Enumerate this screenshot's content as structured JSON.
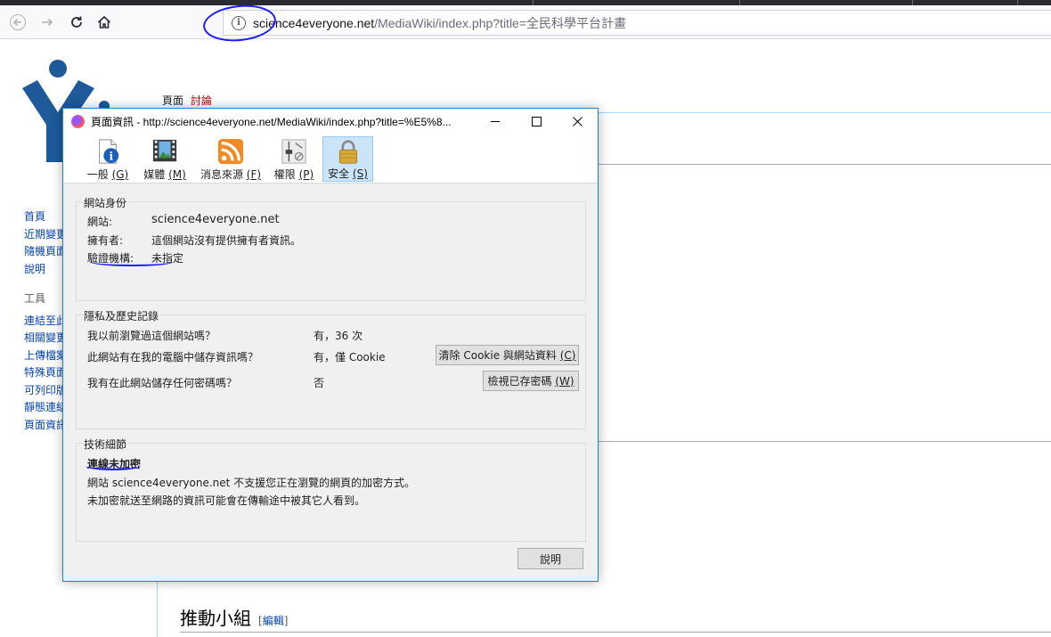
{
  "browser": {
    "url_host": "science4everyone.net",
    "url_path": "/MediaWiki/index.php?title=全民科學平台計畫"
  },
  "wiki": {
    "tab_page": "頁面",
    "tab_talk": "討論",
    "sidebar_main": [
      "首頁",
      "近期變更",
      "隨機頁面",
      "說明"
    ],
    "sidebar_tools_heading": "工具",
    "sidebar_tools": [
      "連結至此的頁面",
      "相關變更",
      "上傳檔案",
      "特殊頁面",
      "可列印版",
      "靜態連結",
      "頁面資訊"
    ],
    "section_title": "推動小組",
    "section_edit_open": "[",
    "section_edit": "編輯",
    "section_edit_close": "]"
  },
  "dialog": {
    "title": "頁面資訊 - http://science4everyone.net/MediaWiki/index.php?title=%E5%8...",
    "tabs": [
      {
        "label": "一般",
        "key": "(G)",
        "icon": "info-icon"
      },
      {
        "label": "媒體",
        "key": "(M)",
        "icon": "media-icon"
      },
      {
        "label": "消息來源",
        "key": "(F)",
        "icon": "rss-icon"
      },
      {
        "label": "權限",
        "key": "(P)",
        "icon": "permissions-icon"
      },
      {
        "label": "安全",
        "key": "(S)",
        "icon": "lock-icon"
      }
    ],
    "identity": {
      "legend": "網站身份",
      "website_label": "網站:",
      "website_value": "science4everyone.net",
      "owner_label": "擁有者:",
      "owner_value": "這個網站沒有提供擁有者資訊。",
      "verifier_label": "驗證機構:",
      "verifier_value": "未指定"
    },
    "privacy": {
      "legend": "隱私及歷史記錄",
      "q1": "我以前瀏覽過這個網站嗎？",
      "a1": "有，36 次",
      "q2": "此網站有在我的電腦中儲存資訊嗎？",
      "a2": "有，僅 Cookie",
      "btn_clear": "清除 Cookie 與網站資料",
      "btn_clear_key": "(C)",
      "q3": "我有在此網站儲存任何密碼嗎？",
      "a3": "否",
      "btn_passwords": "檢視已存密碼",
      "btn_passwords_key": "(W)"
    },
    "technical": {
      "legend": "技術細節",
      "headline": "連線未加密",
      "line1": "網站 science4everyone.net 不支援您正在瀏覽的網頁的加密方式。",
      "line2": "未加密就送至網路的資訊可能會在傳輸途中被其它人看到。"
    },
    "help_button": "說明"
  },
  "colors": {
    "annotation": "#1a1aff",
    "window_border": "#1883d7",
    "link": "#0645ad"
  }
}
